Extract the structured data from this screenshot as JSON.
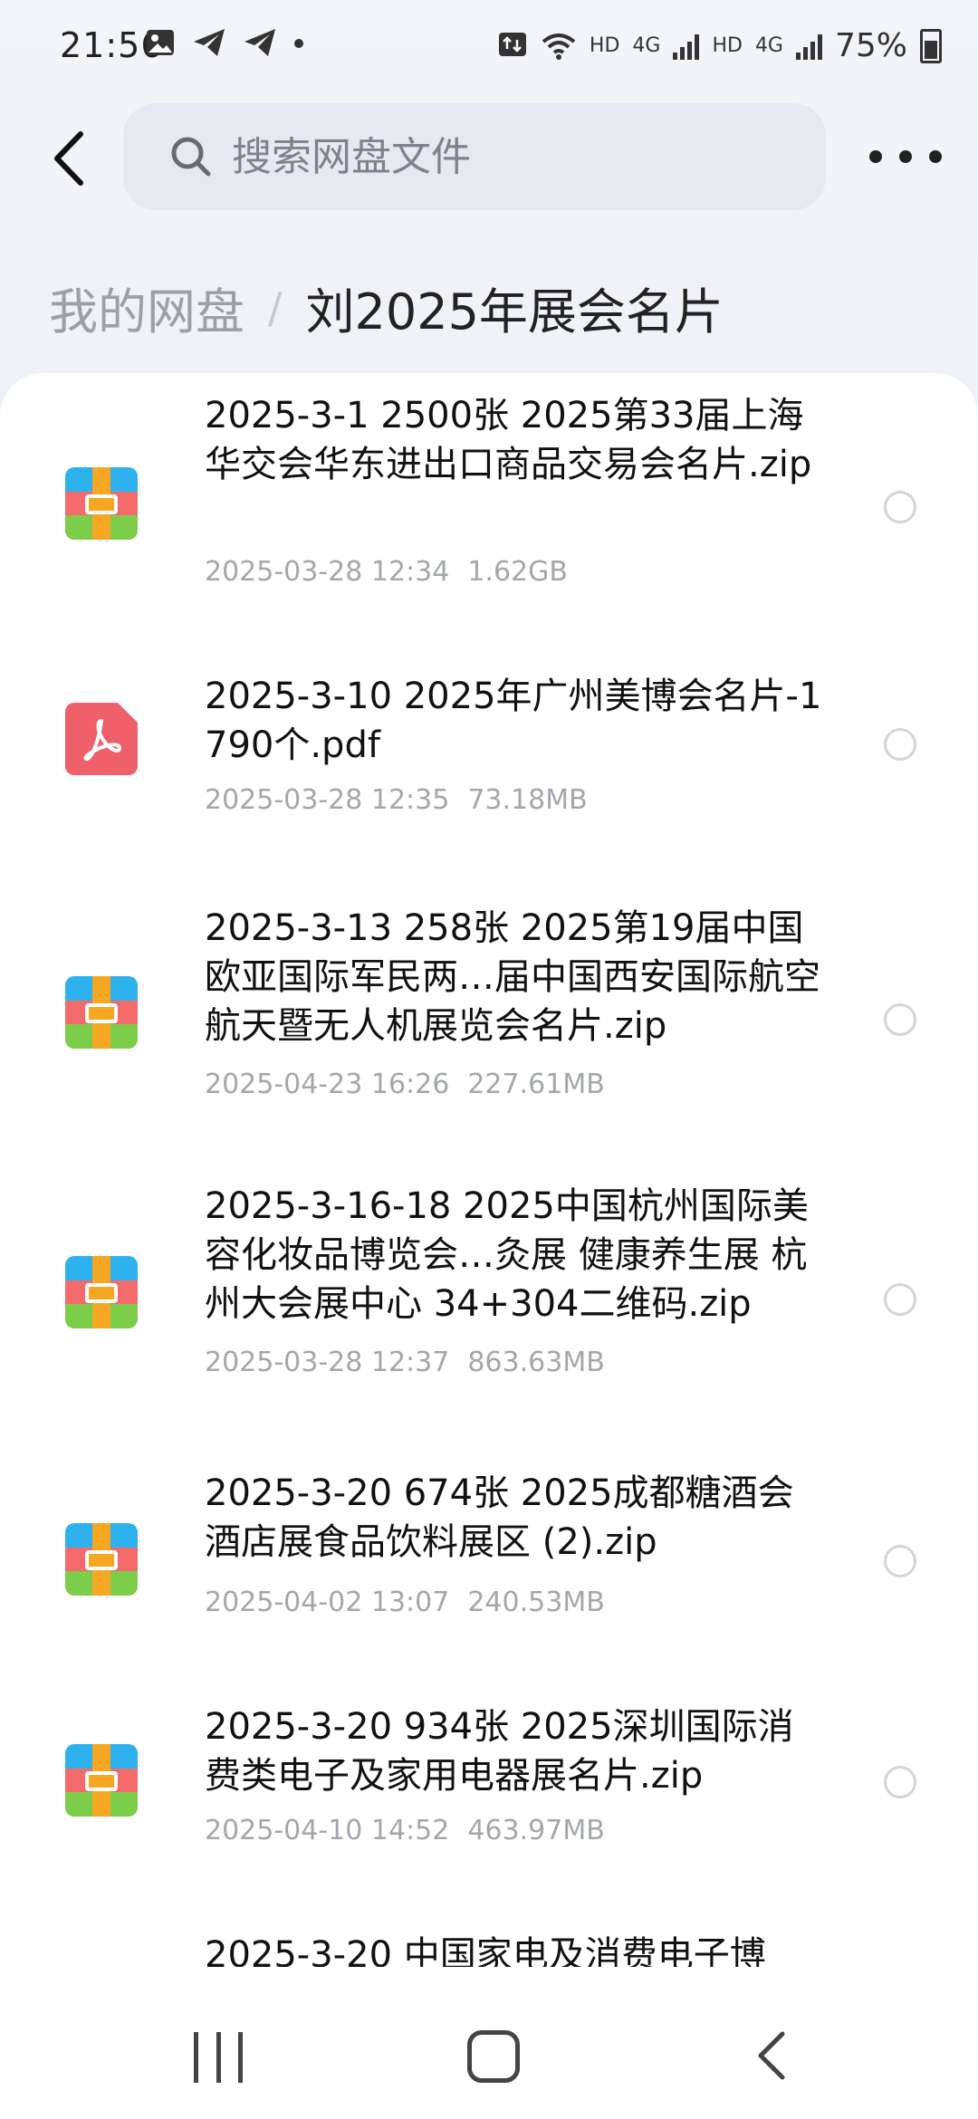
{
  "status_bar": {
    "time": "21:56",
    "network_hd1": "HD",
    "network_4g1": "4G",
    "network_hd2": "HD",
    "network_4g2": "4G",
    "battery": "75%"
  },
  "header": {
    "search_placeholder": "搜索网盘文件"
  },
  "breadcrumb": {
    "root": "我的网盘",
    "separator": "/",
    "current": "刘2025年展会名片"
  },
  "files": [
    {
      "type": "zip",
      "name": "2025-3-1 2500张 2025第33届上海华交会华东进出口商品交易会名片.zip",
      "date": "2025-03-28 12:34",
      "size": "1.62GB"
    },
    {
      "type": "pdf",
      "name": "2025-3-10 2025年广州美博会名片-1790个.pdf",
      "date": "2025-03-28 12:35",
      "size": "73.18MB"
    },
    {
      "type": "zip",
      "name": "2025-3-13 258张 2025第19届中国欧亚国际军民两…届中国西安国际航空航天暨无人机展览会名片.zip",
      "date": "2025-04-23 16:26",
      "size": "227.61MB"
    },
    {
      "type": "zip",
      "name": "2025-3-16-18 2025中国杭州国际美容化妆品博览会…灸展 健康养生展 杭州大会展中心 34+304二维码.zip",
      "date": "2025-03-28 12:37",
      "size": "863.63MB"
    },
    {
      "type": "zip",
      "name": "2025-3-20 674张 2025成都糖酒会酒店展食品饮料展区 (2).zip",
      "date": "2025-04-02 13:07",
      "size": "240.53MB"
    },
    {
      "type": "zip",
      "name": "2025-3-20 934张 2025深圳国际消费类电子及家用电器展名片.zip",
      "date": "2025-04-10 14:52",
      "size": "463.97MB"
    },
    {
      "type": "zip",
      "name": "2025-3-20 中国家电及消费电子博",
      "date": "",
      "size": ""
    }
  ],
  "colors": {
    "zip_blue": "#2db2ee",
    "zip_red": "#f36a6a",
    "zip_green": "#7ccd4a",
    "zip_belt": "#f5a623",
    "pdf_red": "#f0606a",
    "meta_gray": "#a3a7ad"
  },
  "icons": {
    "back": "chevron-left-icon",
    "search": "search-icon",
    "more": "more-horizontal-icon",
    "zip": "archive-zip-icon",
    "pdf": "pdf-file-icon"
  }
}
